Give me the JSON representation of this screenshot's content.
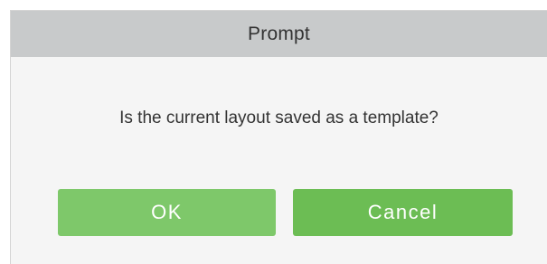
{
  "dialog": {
    "title": "Prompt",
    "message": "Is the current layout saved as a template?",
    "ok_label": "OK",
    "cancel_label": "Cancel"
  },
  "colors": {
    "titlebar_bg": "#c8cacb",
    "dialog_bg": "#f5f5f5",
    "ok_button_bg": "#7ec86a",
    "cancel_button_bg": "#6cbd54",
    "button_text": "#ffffff"
  }
}
